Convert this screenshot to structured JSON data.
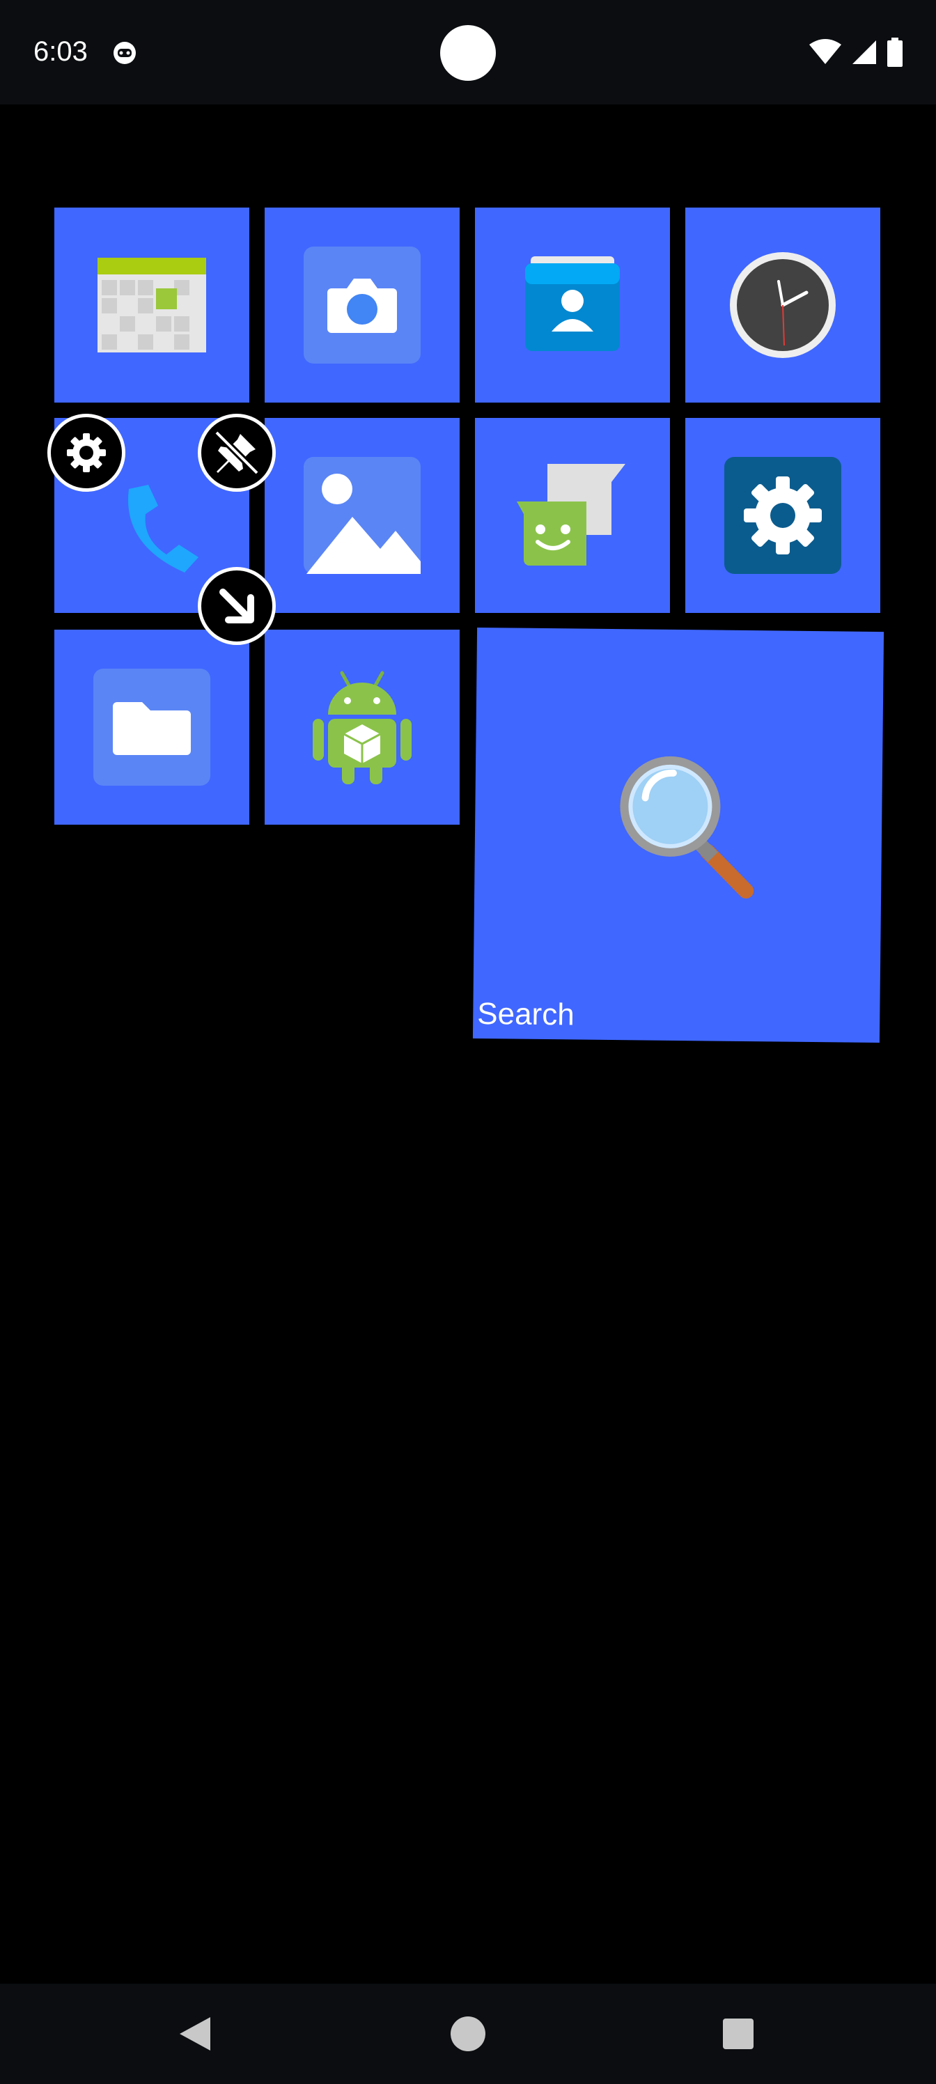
{
  "status_bar": {
    "time": "6:03",
    "icons": [
      "notification-icon",
      "wifi-icon",
      "cell-signal-icon",
      "battery-icon"
    ]
  },
  "tiles": [
    {
      "name": "calendar-tile",
      "icon": "calendar-icon",
      "label": ""
    },
    {
      "name": "camera-tile",
      "icon": "camera-icon",
      "label": ""
    },
    {
      "name": "contacts-tile",
      "icon": "contacts-icon",
      "label": ""
    },
    {
      "name": "clock-tile",
      "icon": "clock-icon",
      "label": ""
    },
    {
      "name": "phone-tile",
      "icon": "phone-icon",
      "label": ""
    },
    {
      "name": "gallery-tile",
      "icon": "gallery-icon",
      "label": ""
    },
    {
      "name": "messages-tile",
      "icon": "messages-icon",
      "label": ""
    },
    {
      "name": "settings-tile",
      "icon": "settings-icon",
      "label": ""
    },
    {
      "name": "files-tile",
      "icon": "folder-icon",
      "label": ""
    },
    {
      "name": "app-installer-tile",
      "icon": "android-package-icon",
      "label": ""
    },
    {
      "name": "search-tile",
      "icon": "magnifier-icon",
      "label": "Search"
    }
  ],
  "tile_color": "#4067ff",
  "edit_controls": [
    "tile-settings-button",
    "unpin-button",
    "resize-button"
  ],
  "nav_bar": {
    "buttons": [
      "back-button",
      "home-button",
      "recents-button"
    ]
  }
}
